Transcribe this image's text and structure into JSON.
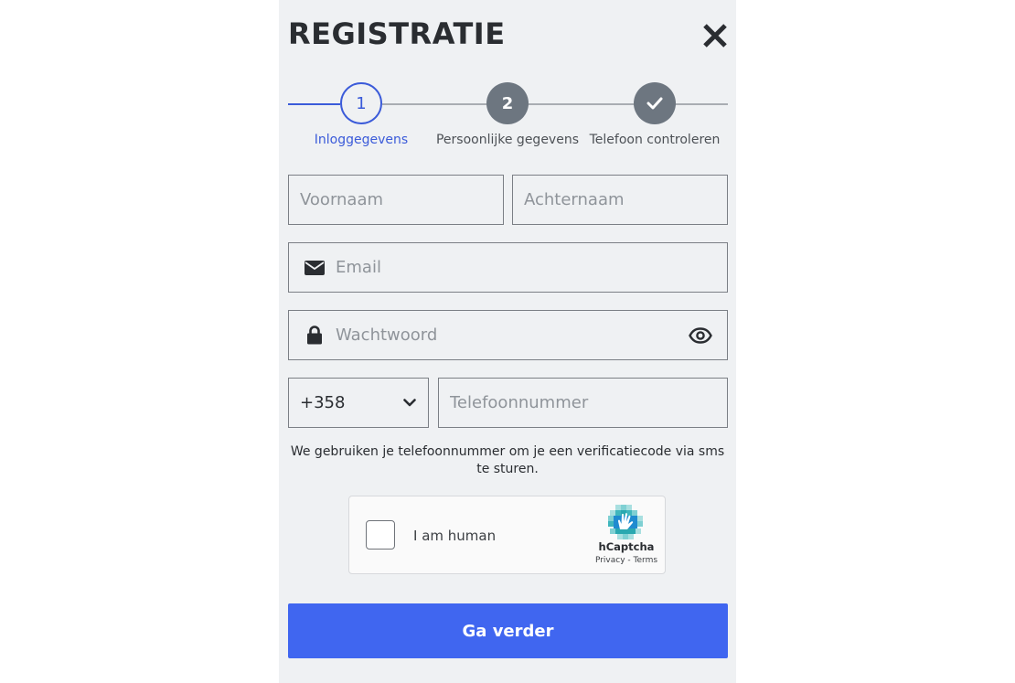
{
  "header": {
    "title": "REGISTRATIE"
  },
  "stepper": {
    "steps": [
      {
        "number": "1",
        "label": "Inloggegevens",
        "state": "active"
      },
      {
        "number": "2",
        "label": "Persoonlijke gegevens",
        "state": "pending"
      },
      {
        "number": "",
        "label": "Telefoon controleren",
        "state": "pending-check"
      }
    ]
  },
  "form": {
    "first_name_placeholder": "Voornaam",
    "last_name_placeholder": "Achternaam",
    "email_placeholder": "Email",
    "password_placeholder": "Wachtwoord",
    "country_code": "+358",
    "phone_placeholder": "Telefoonnummer",
    "phone_hint": "We gebruiken je telefoonnummer om je een verificatiecode via sms te sturen."
  },
  "captcha": {
    "label": "I am human",
    "brand": "hCaptcha",
    "privacy_link": "Privacy",
    "separator": " - ",
    "terms_link": "Terms"
  },
  "submit": {
    "label": "Ga verder"
  },
  "icons": {
    "close": "close-icon",
    "email": "envelope-icon",
    "password": "lock-icon",
    "toggle_password": "eye-icon",
    "dropdown": "chevron-down-icon",
    "check": "check-icon"
  },
  "colors": {
    "panel_bg": "#eff1f3",
    "accent": "#4066f0",
    "active_step": "#3b5bd9",
    "inactive_step": "#6d7680",
    "text": "#2a2d31",
    "placeholder": "#8f949a"
  }
}
